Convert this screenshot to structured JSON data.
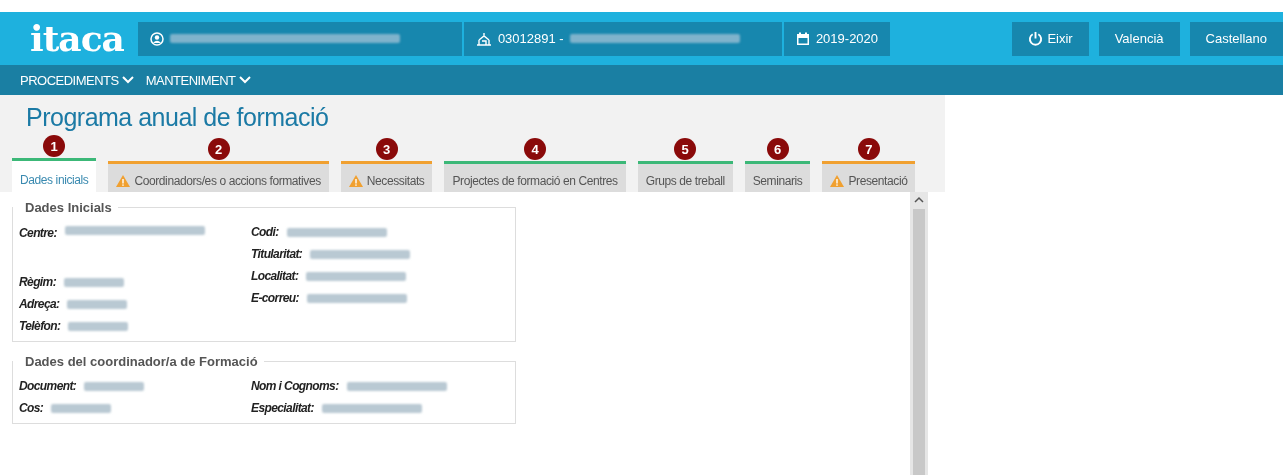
{
  "header": {
    "logo": "itaca",
    "centre_code": "03012891 -",
    "course": "2019-2020",
    "buttons": [
      {
        "label": "Eixir",
        "kind": "power"
      },
      {
        "label": "Valencià",
        "kind": "plain"
      },
      {
        "label": "Castellano",
        "kind": "plain"
      }
    ]
  },
  "nav": {
    "items": [
      "PROCEDIMENTS",
      "MANTENIMENT"
    ]
  },
  "page_title": "Programa anual de formació",
  "tabs": [
    {
      "number": "1",
      "label": "Dades inicials",
      "warning": false,
      "selected": true
    },
    {
      "number": "2",
      "label": "Coordinadors/es o accions formatives",
      "warning": true,
      "selected": false
    },
    {
      "number": "3",
      "label": "Necessitats",
      "warning": true,
      "selected": false
    },
    {
      "number": "4",
      "label": "Projectes de formació en Centres",
      "warning": false,
      "selected": false
    },
    {
      "number": "5",
      "label": "Grups de treball",
      "warning": false,
      "selected": false
    },
    {
      "number": "6",
      "label": "Seminaris",
      "warning": false,
      "selected": false
    },
    {
      "number": "7",
      "label": "Presentació",
      "warning": true,
      "selected": false
    }
  ],
  "sections": [
    {
      "legend": "Dades Inicials",
      "left": [
        "Centre:",
        "Règim:",
        "Adreça:",
        "Telèfon:"
      ],
      "right": [
        "Codi:",
        "Titularitat:",
        "Localitat:",
        "E-correu:"
      ]
    },
    {
      "legend": "Dades del coordinador/a de Formació",
      "left": [
        "Document:",
        "Cos:"
      ],
      "right": [
        "Nom i Cognoms:",
        "Especialitat:"
      ]
    }
  ]
}
